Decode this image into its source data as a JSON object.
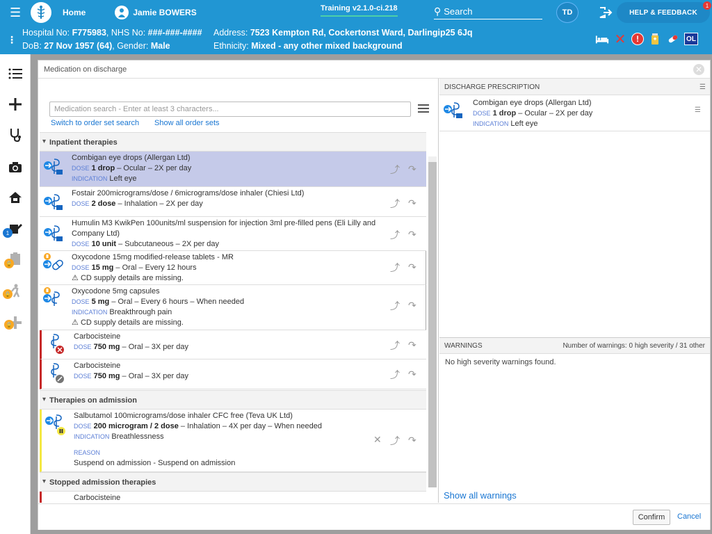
{
  "topbar": {
    "home_label": "Home",
    "patient_name": "Jamie BOWERS",
    "training": "Training v2.1.0-ci.218",
    "search_label": "Search",
    "user_initials": "TD",
    "help_label": "HELP & FEEDBACK",
    "help_badge": "1"
  },
  "banner": {
    "hospital_label": "Hospital No: ",
    "hospital_value": "F775983",
    "nhs_label": ", NHS No: ",
    "nhs_value": "###-###-####",
    "dob_label": "DoB: ",
    "dob_value": "27 Nov 1957 (64)",
    "gender_label": ", Gender: ",
    "gender_value": "Male",
    "address_label": "Address: ",
    "address_value": "7523 Kempton Rd, Cockertonst Ward, Darlingip25 6Jq",
    "ethnicity_label": "Ethnicity: ",
    "ethnicity_value": "Mixed - any other mixed background",
    "ol_label": "OL"
  },
  "sidebar": {
    "badge_count": "1"
  },
  "modal": {
    "title": "Medication on discharge",
    "search_placeholder": "Medication search - Enter at least 3 characters...",
    "link_order_set": "Switch to order set search",
    "link_show_sets": "Show all order sets",
    "sections": {
      "inpatient": "Inpatient therapies",
      "admission": "Therapies on admission",
      "stopped": "Stopped admission therapies"
    },
    "labels": {
      "dose": "DOSE",
      "indication": "INDICATION",
      "reason": "REASON"
    },
    "rows": [
      {
        "name": "Combigan eye drops (Allergan Ltd)",
        "dose": "1 drop",
        "rest": " – Ocular – 2X per day",
        "indication": "Left eye"
      },
      {
        "name": "Fostair 200micrograms/dose / 6micrograms/dose inhaler (Chiesi Ltd)",
        "dose": "2 dose",
        "rest": " – Inhalation – 2X per day"
      },
      {
        "name": "Humulin M3 KwikPen 100units/ml suspension for injection 3ml pre-filled pens (Eli Lilly and",
        "name2": "Company Ltd)",
        "dose": "10 unit",
        "rest": " – Subcutaneous – 2X per day"
      },
      {
        "name": "Oxycodone 15mg modified-release tablets - MR",
        "dose": "15 mg",
        "rest": " – Oral – Every 12 hours",
        "warning": "CD supply details are missing."
      },
      {
        "name": "Oxycodone 5mg capsules",
        "dose": "5 mg",
        "rest": " – Oral – Every 6 hours – When needed",
        "indication": "Breakthrough pain",
        "warning": "CD supply details are missing."
      },
      {
        "name": "Carbocisteine",
        "dose": "750 mg",
        "rest": " – Oral – 3X per day"
      },
      {
        "name": "Carbocisteine",
        "dose": "750 mg",
        "rest": " – Oral – 3X per day"
      },
      {
        "name": "Salbutamol 100micrograms/dose inhaler CFC free (Teva UK Ltd)",
        "dose": "200 microgram / 2 dose",
        "rest": " – Inhalation – 4X per day – When needed",
        "indication": "Breathlessness",
        "reason": "Suspend on admission - Suspend on admission"
      },
      {
        "name": "Carbocisteine"
      }
    ],
    "discharge": {
      "header": "DISCHARGE PRESCRIPTION",
      "name": "Combigan eye drops (Allergan Ltd)",
      "dose": "1 drop",
      "rest": " – Ocular – 2X per day",
      "indication": "Left eye"
    },
    "warnings": {
      "header": "WARNINGS",
      "count": "Number of warnings: 0 high severity / 31 other",
      "body": "No high severity warnings found.",
      "show_all": "Show all warnings"
    },
    "confirm": "Confirm",
    "cancel": "Cancel"
  },
  "colors": {
    "brand": "#2196d3",
    "selected_row": "#c5cae9",
    "red_bar": "#c62828",
    "yellow_bar": "#f4e842",
    "link": "#1976d2"
  }
}
